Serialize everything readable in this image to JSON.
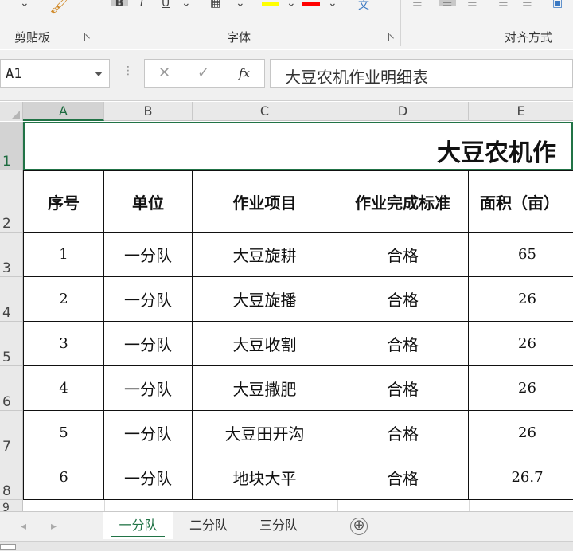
{
  "ribbon": {
    "groups": [
      {
        "label": "剪贴板"
      },
      {
        "label": "字体"
      },
      {
        "label": "对齐方式"
      }
    ],
    "font_color_bar": "#ff0000",
    "highlight_bar": "#ffff00"
  },
  "formula_bar": {
    "name_box": "A1",
    "fx_symbol": "fx",
    "cancel_symbol": "✕",
    "enter_symbol": "✓",
    "content": "大豆农机作业明细表"
  },
  "grid": {
    "columns": [
      "A",
      "B",
      "C",
      "D",
      "E"
    ],
    "rows": [
      "1",
      "2",
      "3",
      "4",
      "5",
      "6",
      "7",
      "8",
      "9"
    ],
    "title": "大豆农机作",
    "headers": [
      "序号",
      "单位",
      "作业项目",
      "作业完成标准",
      "面积（亩）"
    ],
    "data": [
      [
        "1",
        "一分队",
        "大豆旋耕",
        "合格",
        "65"
      ],
      [
        "2",
        "一分队",
        "大豆旋播",
        "合格",
        "26"
      ],
      [
        "3",
        "一分队",
        "大豆收割",
        "合格",
        "26"
      ],
      [
        "4",
        "一分队",
        "大豆撒肥",
        "合格",
        "26"
      ],
      [
        "5",
        "一分队",
        "大豆田开沟",
        "合格",
        "26"
      ],
      [
        "6",
        "一分队",
        "地块大平",
        "合格",
        "26.7"
      ]
    ]
  },
  "sheets": {
    "tabs": [
      "一分队",
      "二分队",
      "三分队"
    ],
    "active": "一分队",
    "add_symbol": "⊕"
  },
  "colors": {
    "accent": "#217346",
    "selected_header": "#d3d3d3"
  }
}
